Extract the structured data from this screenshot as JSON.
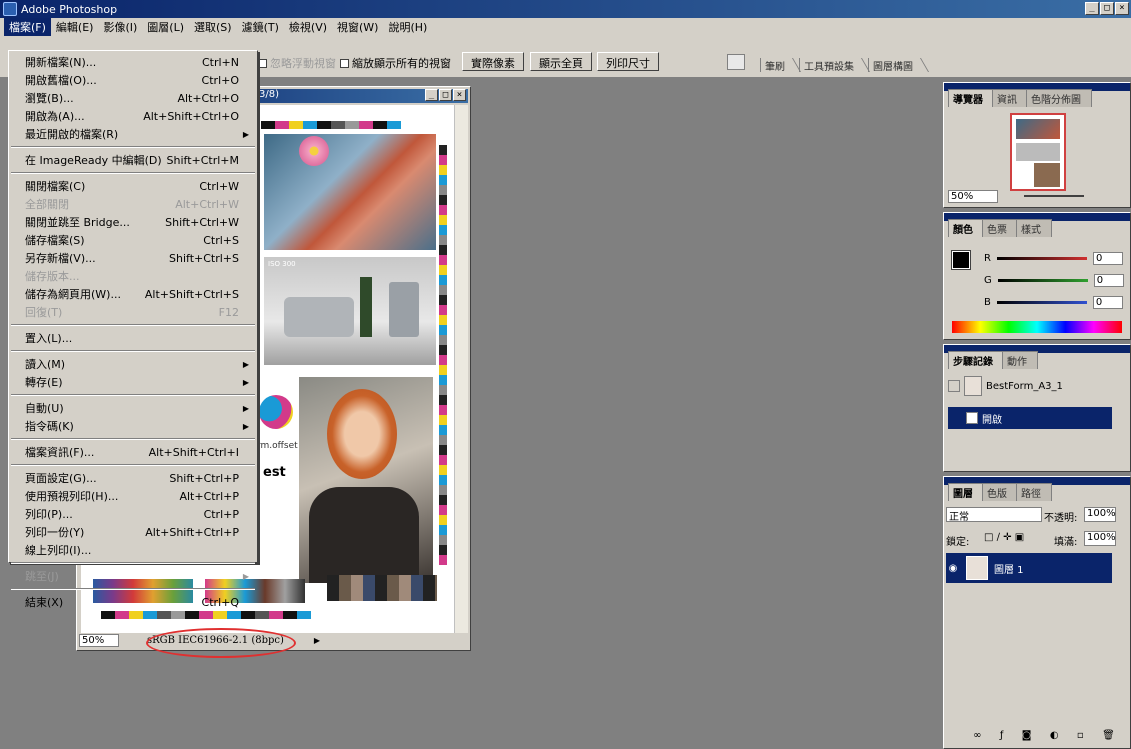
{
  "app": {
    "title": "Adobe Photoshop"
  },
  "menubar": [
    "檔案(F)",
    "編輯(E)",
    "影像(I)",
    "圖層(L)",
    "選取(S)",
    "濾鏡(T)",
    "檢視(V)",
    "視窗(W)",
    "說明(H)"
  ],
  "options": {
    "ignore_floating": "忽略浮動視窗",
    "resize_all": "縮放顯示所有的視窗",
    "actual_pixels": "實際像素",
    "fit_screen": "顯示全頁",
    "print_size": "列印尺寸"
  },
  "palette_well": [
    "筆刷",
    "工具預設集",
    "圖層構圖"
  ],
  "file_menu": [
    {
      "label": "開新檔案(N)...",
      "shortcut": "Ctrl+N"
    },
    {
      "label": "開啟舊檔(O)...",
      "shortcut": "Ctrl+O"
    },
    {
      "label": "瀏覽(B)...",
      "shortcut": "Alt+Ctrl+O"
    },
    {
      "label": "開啟為(A)...",
      "shortcut": "Alt+Shift+Ctrl+O"
    },
    {
      "label": "最近開啟的檔案(R)",
      "submenu": true
    },
    {
      "separator": true
    },
    {
      "label": "在 ImageReady 中編輯(D)",
      "shortcut": "Shift+Ctrl+M"
    },
    {
      "separator": true
    },
    {
      "label": "關閉檔案(C)",
      "shortcut": "Ctrl+W"
    },
    {
      "label": "全部關閉",
      "shortcut": "Alt+Ctrl+W",
      "disabled": true
    },
    {
      "label": "關閉並跳至 Bridge...",
      "shortcut": "Shift+Ctrl+W"
    },
    {
      "label": "儲存檔案(S)",
      "shortcut": "Ctrl+S"
    },
    {
      "label": "另存新檔(V)...",
      "shortcut": "Shift+Ctrl+S"
    },
    {
      "label": "儲存版本...",
      "disabled": true
    },
    {
      "label": "儲存為網頁用(W)...",
      "shortcut": "Alt+Shift+Ctrl+S"
    },
    {
      "label": "回復(T)",
      "shortcut": "F12",
      "disabled": true
    },
    {
      "separator": true
    },
    {
      "label": "置入(L)..."
    },
    {
      "separator": true
    },
    {
      "label": "讀入(M)",
      "submenu": true
    },
    {
      "label": "轉存(E)",
      "submenu": true
    },
    {
      "separator": true
    },
    {
      "label": "自動(U)",
      "submenu": true
    },
    {
      "label": "指令碼(K)",
      "submenu": true
    },
    {
      "separator": true
    },
    {
      "label": "檔案資訊(F)...",
      "shortcut": "Alt+Shift+Ctrl+I"
    },
    {
      "separator": true
    },
    {
      "label": "頁面設定(G)...",
      "shortcut": "Shift+Ctrl+P"
    },
    {
      "label": "使用預視列印(H)...",
      "shortcut": "Alt+Ctrl+P"
    },
    {
      "label": "列印(P)...",
      "shortcut": "Ctrl+P"
    },
    {
      "label": "列印一份(Y)",
      "shortcut": "Alt+Shift+Ctrl+P"
    },
    {
      "label": "線上列印(I)..."
    },
    {
      "separator": true
    },
    {
      "label": "跳至(J)",
      "submenu": true,
      "disabled": true
    },
    {
      "separator": true
    },
    {
      "label": "結束(X)",
      "shortcut": "Ctrl+Q"
    }
  ],
  "document": {
    "title_suffix": "3/8)",
    "zoom": "50%",
    "profile": "sRGB IEC61966-2.1 (8bpc)",
    "canvas_texts": {
      "iso": "ISO 300",
      "offset": "rm.offset",
      "est": "est"
    }
  },
  "navigator": {
    "tabs": [
      "導覽器",
      "資訊",
      "色階分佈圖"
    ],
    "zoom": "50%"
  },
  "color": {
    "tabs": [
      "顏色",
      "色票",
      "樣式"
    ],
    "channels": [
      {
        "name": "R",
        "value": "0",
        "color": "#d03030"
      },
      {
        "name": "G",
        "value": "0",
        "color": "#30a030"
      },
      {
        "name": "B",
        "value": "0",
        "color": "#3050d0"
      }
    ]
  },
  "history": {
    "tabs": [
      "步驟記錄",
      "動作"
    ],
    "snapshot": "BestForm_A3_1",
    "step": "開啟"
  },
  "layers": {
    "tabs": [
      "圖層",
      "色版",
      "路徑"
    ],
    "blend_mode": "正常",
    "opacity_label": "不透明:",
    "opacity": "100%",
    "lock_label": "鎖定:",
    "fill_label": "填滿:",
    "fill": "100%",
    "layer_name": "圖層 1"
  }
}
